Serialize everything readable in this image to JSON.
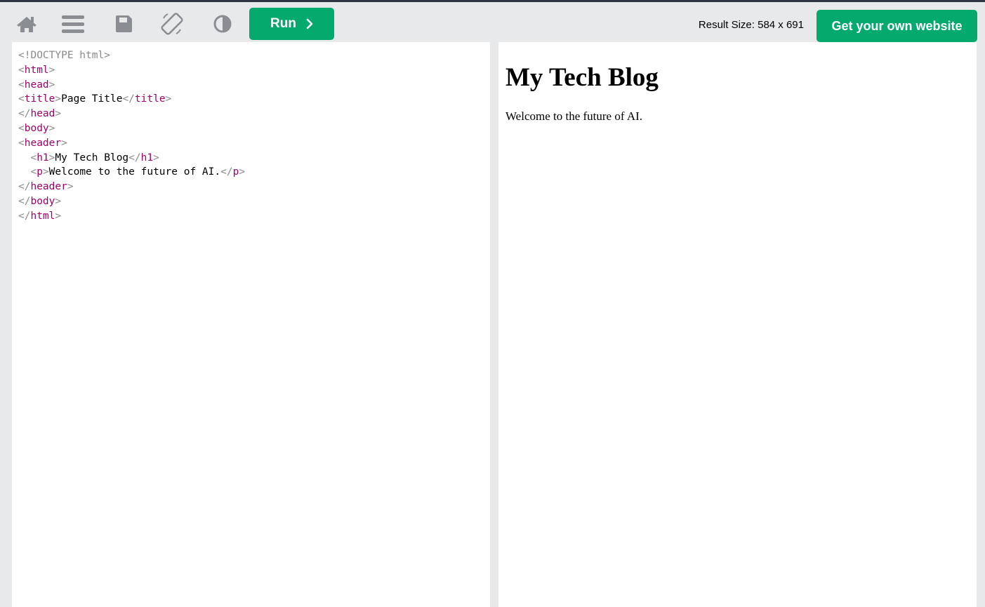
{
  "toolbar": {
    "icons": [
      "home-icon",
      "menu-icon",
      "save-icon",
      "rotate-icon",
      "contrast-icon"
    ],
    "run_label": "Run",
    "result_size_label": "Result Size: 584 x 691",
    "own_site_label": "Get your own website",
    "accent_color": "#04aa6d"
  },
  "editor": {
    "lines": [
      [
        {
          "b": "<!DOCTYPE html>"
        }
      ],
      [
        {
          "b": "<"
        },
        {
          "t": "html"
        },
        {
          "b": ">"
        }
      ],
      [
        {
          "b": "<"
        },
        {
          "t": "head"
        },
        {
          "b": ">"
        }
      ],
      [
        {
          "b": "<"
        },
        {
          "t": "title"
        },
        {
          "b": ">"
        },
        {
          "x": "Page Title"
        },
        {
          "b": "</"
        },
        {
          "t": "title"
        },
        {
          "b": ">"
        }
      ],
      [
        {
          "b": "</"
        },
        {
          "t": "head"
        },
        {
          "b": ">"
        }
      ],
      [
        {
          "b": "<"
        },
        {
          "t": "body"
        },
        {
          "b": ">"
        }
      ],
      [
        {
          "b": "<"
        },
        {
          "t": "header"
        },
        {
          "b": ">"
        }
      ],
      [
        {
          "x": "  "
        },
        {
          "b": "<"
        },
        {
          "t": "h1"
        },
        {
          "b": ">"
        },
        {
          "x": "My Tech Blog"
        },
        {
          "b": "</"
        },
        {
          "t": "h1"
        },
        {
          "b": ">"
        }
      ],
      [
        {
          "x": "  "
        },
        {
          "b": "<"
        },
        {
          "t": "p"
        },
        {
          "b": ">"
        },
        {
          "x": "Welcome to the future of AI."
        },
        {
          "b": "</"
        },
        {
          "t": "p"
        },
        {
          "b": ">"
        }
      ],
      [
        {
          "b": "</"
        },
        {
          "t": "header"
        },
        {
          "b": ">"
        }
      ],
      [
        {
          "b": "</"
        },
        {
          "t": "body"
        },
        {
          "b": ">"
        }
      ],
      [
        {
          "b": "</"
        },
        {
          "t": "html"
        },
        {
          "b": ">"
        }
      ]
    ]
  },
  "result": {
    "heading": "My Tech Blog",
    "paragraph": "Welcome to the future of AI."
  }
}
